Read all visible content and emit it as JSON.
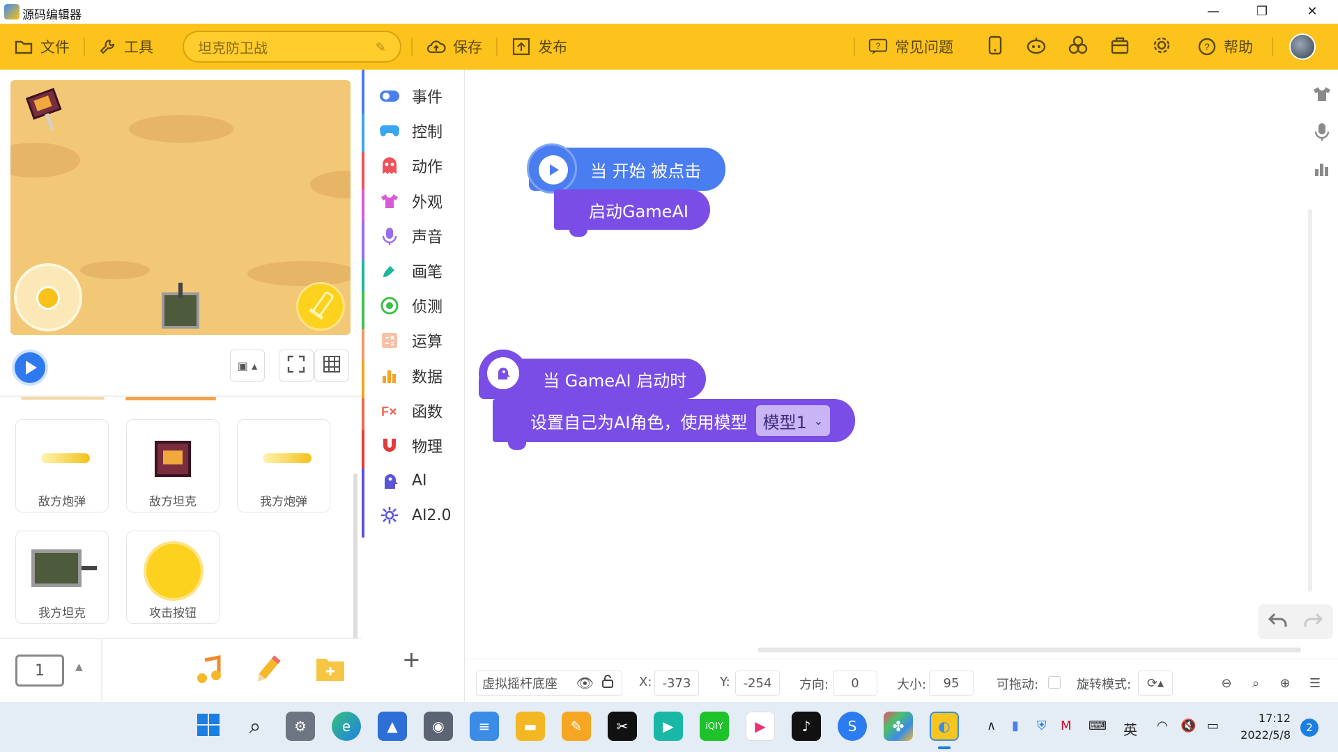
{
  "window": {
    "title": "源码编辑器",
    "minimize": "—",
    "restore": "❐",
    "close": "✕"
  },
  "toolbar": {
    "file": "文件",
    "tools": "工具",
    "project_name": "坦克防卫战",
    "save": "保存",
    "publish": "发布",
    "faq": "常见问题",
    "help": "帮助"
  },
  "stage": {
    "play_label": "▶"
  },
  "sprites": [
    {
      "name": "敌方炮弹"
    },
    {
      "name": "敌方坦克"
    },
    {
      "name": "我方炮弹"
    },
    {
      "name": "我方坦克"
    },
    {
      "name": "攻击按钮"
    }
  ],
  "scene": {
    "page_number": "1"
  },
  "categories": [
    {
      "label": "事件",
      "color": "#4a7df0",
      "icon": "toggle-icon"
    },
    {
      "label": "控制",
      "color": "#3ba6f0",
      "icon": "gamepad-icon"
    },
    {
      "label": "动作",
      "color": "#f0515b",
      "icon": "ghost-icon"
    },
    {
      "label": "外观",
      "color": "#d85ad6",
      "icon": "shirt-icon"
    },
    {
      "label": "声音",
      "color": "#9a6cf0",
      "icon": "microphone-icon"
    },
    {
      "label": "画笔",
      "color": "#21b59a",
      "icon": "brush-icon"
    },
    {
      "label": "侦测",
      "color": "#3ebf49",
      "icon": "radar-icon"
    },
    {
      "label": "运算",
      "color": "#f09a6a",
      "icon": "calculator-icon"
    },
    {
      "label": "数据",
      "color": "#f2a423",
      "icon": "bar-chart-icon"
    },
    {
      "label": "函数",
      "color": "#ef6a54",
      "icon": "function-icon"
    },
    {
      "label": "物理",
      "color": "#e23b3b",
      "icon": "magnet-icon"
    },
    {
      "label": "AI",
      "color": "#5b54d6",
      "icon": "ai-head-icon"
    },
    {
      "label": "AI2.0",
      "color": "#5b54d6",
      "icon": "ai-gear-icon"
    }
  ],
  "add_category": "+",
  "blocks": {
    "hat1": "当 开始 被点击",
    "cmd1": "启动GameAI",
    "hat2": "当 GameAI 启动时",
    "cmd2": "设置自己为AI角色，使用模型",
    "model_option": "模型1"
  },
  "status": {
    "sprite_name": "虚拟摇杆底座",
    "x_label": "X:",
    "x_value": "-373",
    "y_label": "Y:",
    "y_value": "-254",
    "direction_label": "方向:",
    "direction_value": "0",
    "size_label": "大小:",
    "size_value": "95",
    "draggable_label": "可拖动:",
    "rotation_label": "旋转模式:"
  },
  "taskbar": {
    "ime": "英",
    "time": "17:12",
    "date": "2022/5/8",
    "notification_count": "2"
  }
}
